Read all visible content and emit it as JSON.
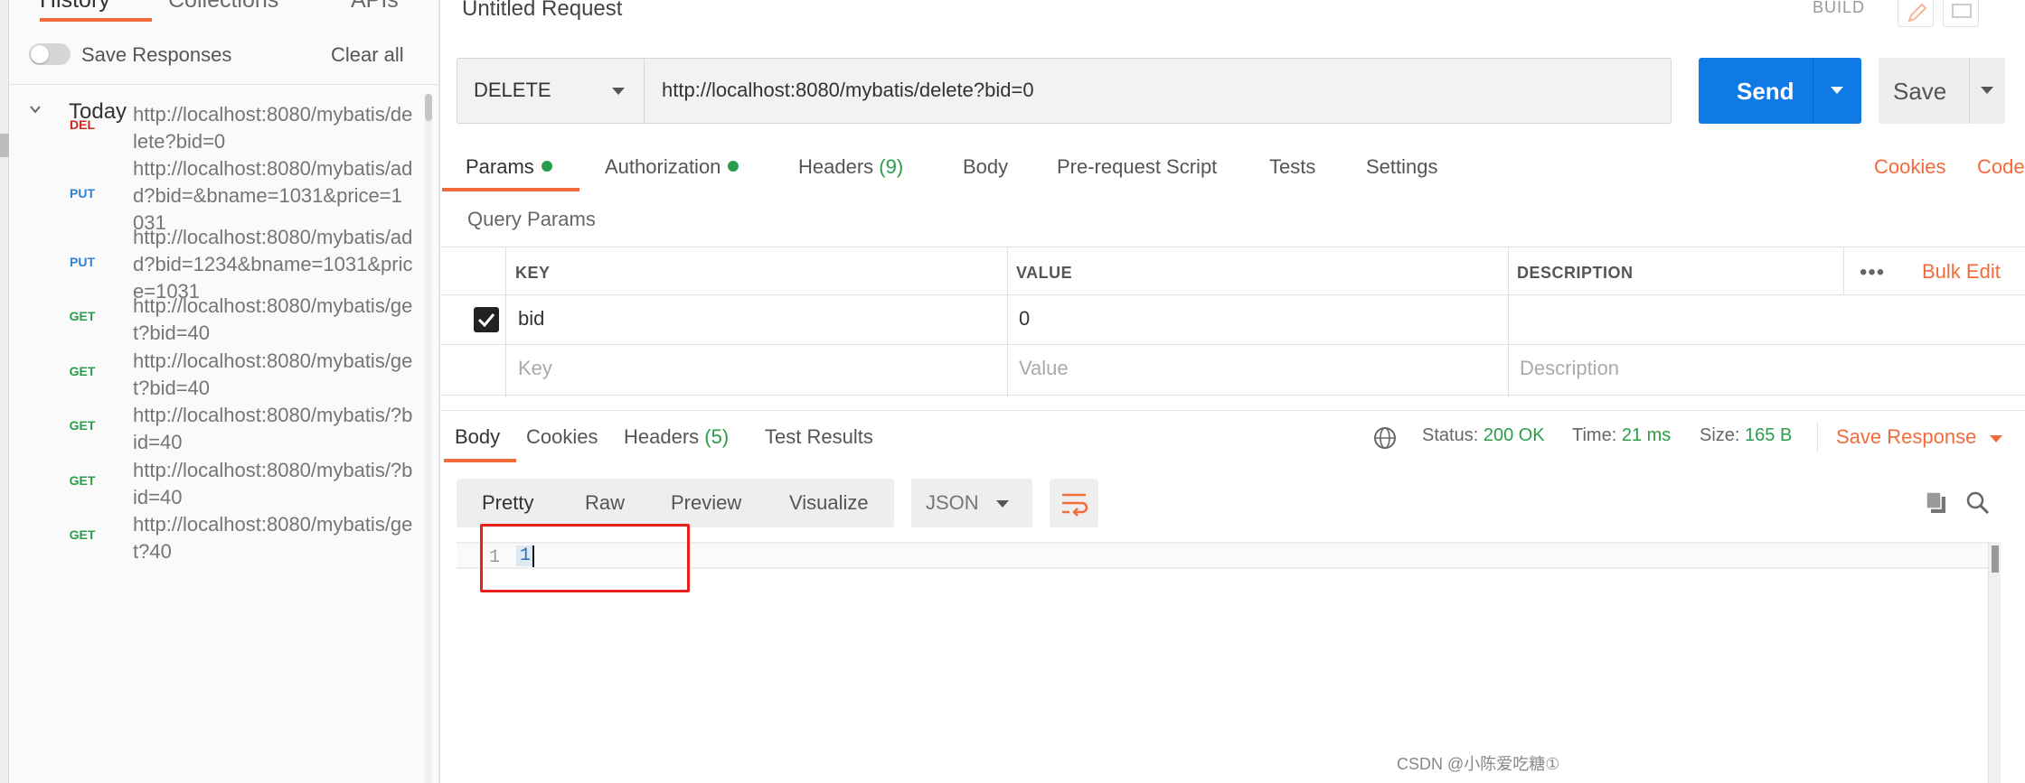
{
  "sidebar": {
    "tabs": [
      {
        "label": "History",
        "active": true
      },
      {
        "label": "Collections",
        "active": false
      },
      {
        "label": "APIs",
        "active": false
      }
    ],
    "save_responses_label": "Save Responses",
    "save_responses_enabled": false,
    "clear_all_label": "Clear all",
    "group_label": "Today",
    "items": [
      {
        "method": "DEL",
        "url": "http://localhost:8080/mybatis/delete?bid=0"
      },
      {
        "method": "PUT",
        "url": "http://localhost:8080/mybatis/add?bid=&bname=1031&price=1031"
      },
      {
        "method": "PUT",
        "url": "http://localhost:8080/mybatis/add?bid=1234&bname=1031&price=1031"
      },
      {
        "method": "GET",
        "url": "http://localhost:8080/mybatis/get?bid=40"
      },
      {
        "method": "GET",
        "url": "http://localhost:8080/mybatis/get?bid=40"
      },
      {
        "method": "GET",
        "url": "http://localhost:8080/mybatis/?bid=40"
      },
      {
        "method": "GET",
        "url": "http://localhost:8080/mybatis/?bid=40"
      },
      {
        "method": "GET",
        "url": "http://localhost:8080/mybatis/get?40"
      }
    ]
  },
  "request": {
    "title": "Untitled Request",
    "build_label": "BUILD",
    "method": "DELETE",
    "url": "http://localhost:8080/mybatis/delete?bid=0",
    "send_label": "Send",
    "save_label": "Save",
    "tabs": [
      {
        "label": "Params",
        "dot": true,
        "active": true
      },
      {
        "label": "Authorization",
        "dot": true,
        "active": false
      },
      {
        "label": "Headers",
        "count": "(9)",
        "active": false
      },
      {
        "label": "Body",
        "active": false
      },
      {
        "label": "Pre-request Script",
        "active": false
      },
      {
        "label": "Tests",
        "active": false
      },
      {
        "label": "Settings",
        "active": false
      }
    ],
    "cookies_label": "Cookies",
    "code_label": "Code",
    "query_params_title": "Query Params",
    "table": {
      "headers": {
        "key": "KEY",
        "value": "VALUE",
        "description": "DESCRIPTION"
      },
      "more_label": "•••",
      "bulk_edit_label": "Bulk Edit",
      "rows": [
        {
          "checked": true,
          "key": "bid",
          "value": "0",
          "description": ""
        }
      ],
      "placeholders": {
        "key": "Key",
        "value": "Value",
        "description": "Description"
      }
    }
  },
  "response": {
    "tabs": [
      {
        "label": "Body",
        "active": true
      },
      {
        "label": "Cookies",
        "active": false
      },
      {
        "label": "Headers",
        "count": "(5)",
        "active": false
      },
      {
        "label": "Test Results",
        "active": false
      }
    ],
    "status_label": "Status:",
    "status_value": "200 OK",
    "time_label": "Time:",
    "time_value": "21 ms",
    "size_label": "Size:",
    "size_value": "165 B",
    "save_response_label": "Save Response",
    "views": [
      "Pretty",
      "Raw",
      "Preview",
      "Visualize"
    ],
    "active_view": "Pretty",
    "format": "JSON",
    "line_number": "1",
    "body": "1"
  },
  "watermark": "CSDN @小陈爱吃糖①",
  "colors": {
    "accent": "#f26b3a",
    "send_blue": "#0f7ae5",
    "success_green": "#2a9d4a",
    "delete_red": "#d0261b",
    "put_blue": "#2d7fd8",
    "annotation_red": "#e8211b"
  }
}
